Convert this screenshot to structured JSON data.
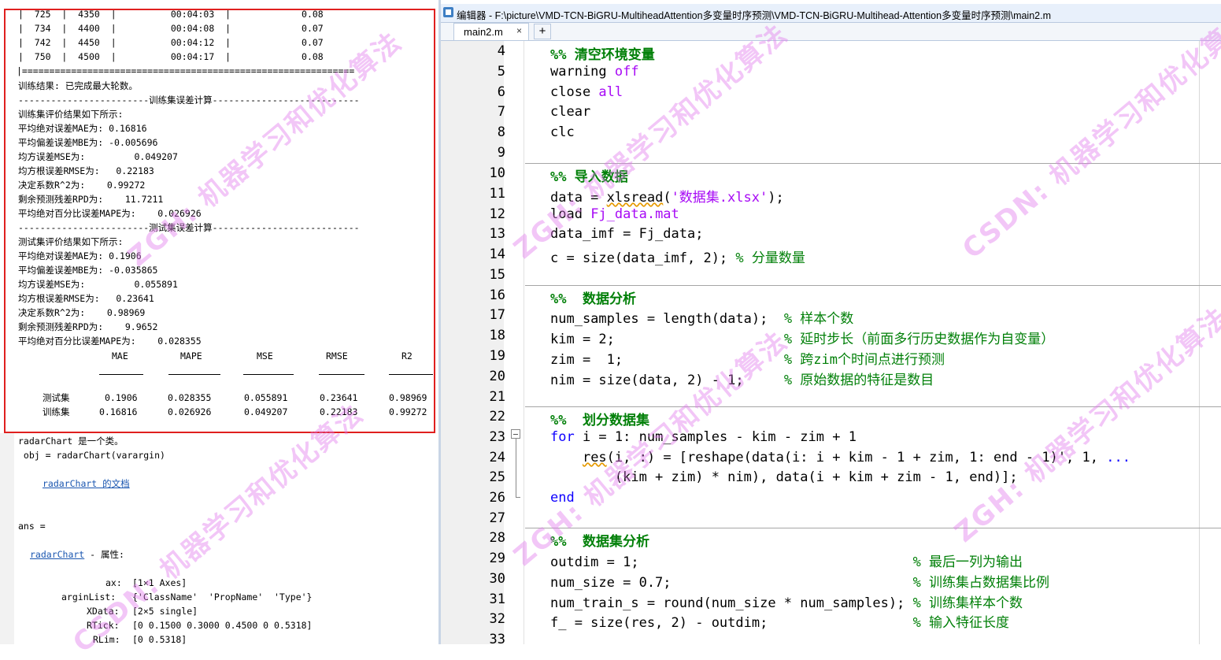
{
  "command_window": {
    "table_rows": [
      "|  725  |  4350  |          00:04:03  |             0.08",
      "|  734  |  4400  |          00:04:08  |             0.07",
      "|  742  |  4450  |          00:04:12  |             0.07",
      "|  750  |  4500  |          00:04:17  |             0.08"
    ],
    "table_border": "|=============================================================",
    "train_result": "训练结果: 已完成最大轮数。",
    "train_err_header": "------------------------训练集误差计算---------------------------",
    "train_eval_intro": "训练集评价结果如下所示:",
    "train_metrics": [
      "平均绝对误差MAE为: 0.16816",
      "平均偏差误差MBE为: -0.005696",
      "均方误差MSE为:         0.049207",
      "均方根误差RMSE为:   0.22183",
      "决定系数R^2为:    0.99272",
      "剩余预测残差RPD为:    11.7211",
      "平均绝对百分比误差MAPE为:    0.026926"
    ],
    "test_err_header": "------------------------测试集误差计算---------------------------",
    "test_eval_intro": "测试集评价结果如下所示:",
    "test_metrics": [
      "平均绝对误差MAE为: 0.1906",
      "平均偏差误差MBE为: -0.035865",
      "均方误差MSE为:         0.055891",
      "均方根误差RMSE为:   0.23641",
      "决定系数R^2为:    0.98969",
      "剩余预测残差RPD为:    9.9652",
      "平均绝对百分比误差MAPE为:    0.028355"
    ],
    "summary_table": {
      "columns": [
        "MAE",
        "MAPE",
        "MSE",
        "RMSE",
        "R2"
      ],
      "rows": [
        {
          "label": "测试集",
          "values": [
            "0.1906",
            "0.028355",
            "0.055891",
            "0.23641",
            "0.98969"
          ]
        },
        {
          "label": "训练集",
          "values": [
            "0.16816",
            "0.026926",
            "0.049207",
            "0.22183",
            "0.99272"
          ]
        }
      ]
    },
    "radar_class_line": "radarChart 是一个类。",
    "radar_ctor_line": " obj = radarChart(varargin)",
    "radar_doc_link": "radarChart 的文档",
    "ans_line": "ans =",
    "radar_prop_link": "radarChart",
    "radar_prop_suffix": " - 属性:",
    "properties": [
      {
        "name": "ax:",
        "value": "[1×1 Axes]"
      },
      {
        "name": "arginList:",
        "value": "{'ClassName'  'PropName'  'Type'}"
      },
      {
        "name": "XData:",
        "value": "[2×5 single]"
      },
      {
        "name": "RTick:",
        "value": "[0 0.1500 0.3000 0.4500 0 0.5318]"
      },
      {
        "name": "RLim:",
        "value": "[0 0.5318]"
      }
    ]
  },
  "editor": {
    "title": "编辑器 - F:\\picture\\VMD-TCN-BiGRU-MultiheadAttention多变量时序预测\\VMD-TCN-BiGRU-Multihead-Attention多变量时序预测\\main2.m",
    "tab_label": "main2.m",
    "tab_close": "×",
    "tab_add": "+",
    "line_numbers": [
      "4",
      "5",
      "6",
      "7",
      "8",
      "9",
      "10",
      "11",
      "12",
      "13",
      "14",
      "15",
      "16",
      "17",
      "18",
      "19",
      "20",
      "21",
      "22",
      "23",
      "24",
      "25",
      "26",
      "27",
      "28",
      "29",
      "30",
      "31",
      "32",
      "33"
    ],
    "code": {
      "l4_a": "%% ",
      "l4_b": "清空环境变量",
      "l5_a": "warning ",
      "l5_b": "off",
      "l6_a": "close ",
      "l6_b": "all",
      "l7": "clear",
      "l8": "clc",
      "l10_a": "%% ",
      "l10_b": "导入数据",
      "l11_a": "data = ",
      "l11_b": "xlsread",
      "l11_c": "(",
      "l11_d": "'数据集.xlsx'",
      "l11_e": ");",
      "l12_a": "load ",
      "l12_b": "Fj_data.mat",
      "l13": "data_imf = Fj_data;",
      "l14_a": "c = size(data_imf, 2); ",
      "l14_b": "% 分量数量",
      "l16_a": "%%  ",
      "l16_b": "数据分析",
      "l17_a": "num_samples = length(data);  ",
      "l17_b": "% 样本个数",
      "l18_a": "kim = 2;                     ",
      "l18_b": "% 延时步长（前面多行历史数据作为自变量）",
      "l19_a": "zim =  1;                    ",
      "l19_b": "% 跨zim个时间点进行预测",
      "l20_a": "nim = size(data, 2) - 1;     ",
      "l20_b": "% 原始数据的特征是数目",
      "l22_a": "%%  ",
      "l22_b": "划分数据集",
      "l23_a": "for",
      "l23_b": " i = 1: num_samples - kim - zim + 1",
      "l24_a": "    ",
      "l24_b": "res",
      "l24_c": "(i, :) = [reshape(data(i: i + kim - 1 + zim, 1: end - 1)', 1, ",
      "l24_d": "...",
      "l25": "        (kim + zim) * nim), data(i + kim + zim - 1, end)];",
      "l26": "end",
      "l28_a": "%%  ",
      "l28_b": "数据集分析",
      "l29_a": "outdim = 1;                                  ",
      "l29_b": "% 最后一列为输出",
      "l30_a": "num_size = 0.7;                              ",
      "l30_b": "% 训练集占数据集比例",
      "l31_a": "num_train_s = round(num_size * num_samples); ",
      "l31_b": "% 训练集样本个数",
      "l32_a": "f_ = size(res, 2) - outdim;                  ",
      "l32_b": "% 输入特征长度"
    }
  },
  "watermark": "ZGH: 机器学习和优化算法",
  "watermark2": "CSDN: 机器学习和优化算法"
}
